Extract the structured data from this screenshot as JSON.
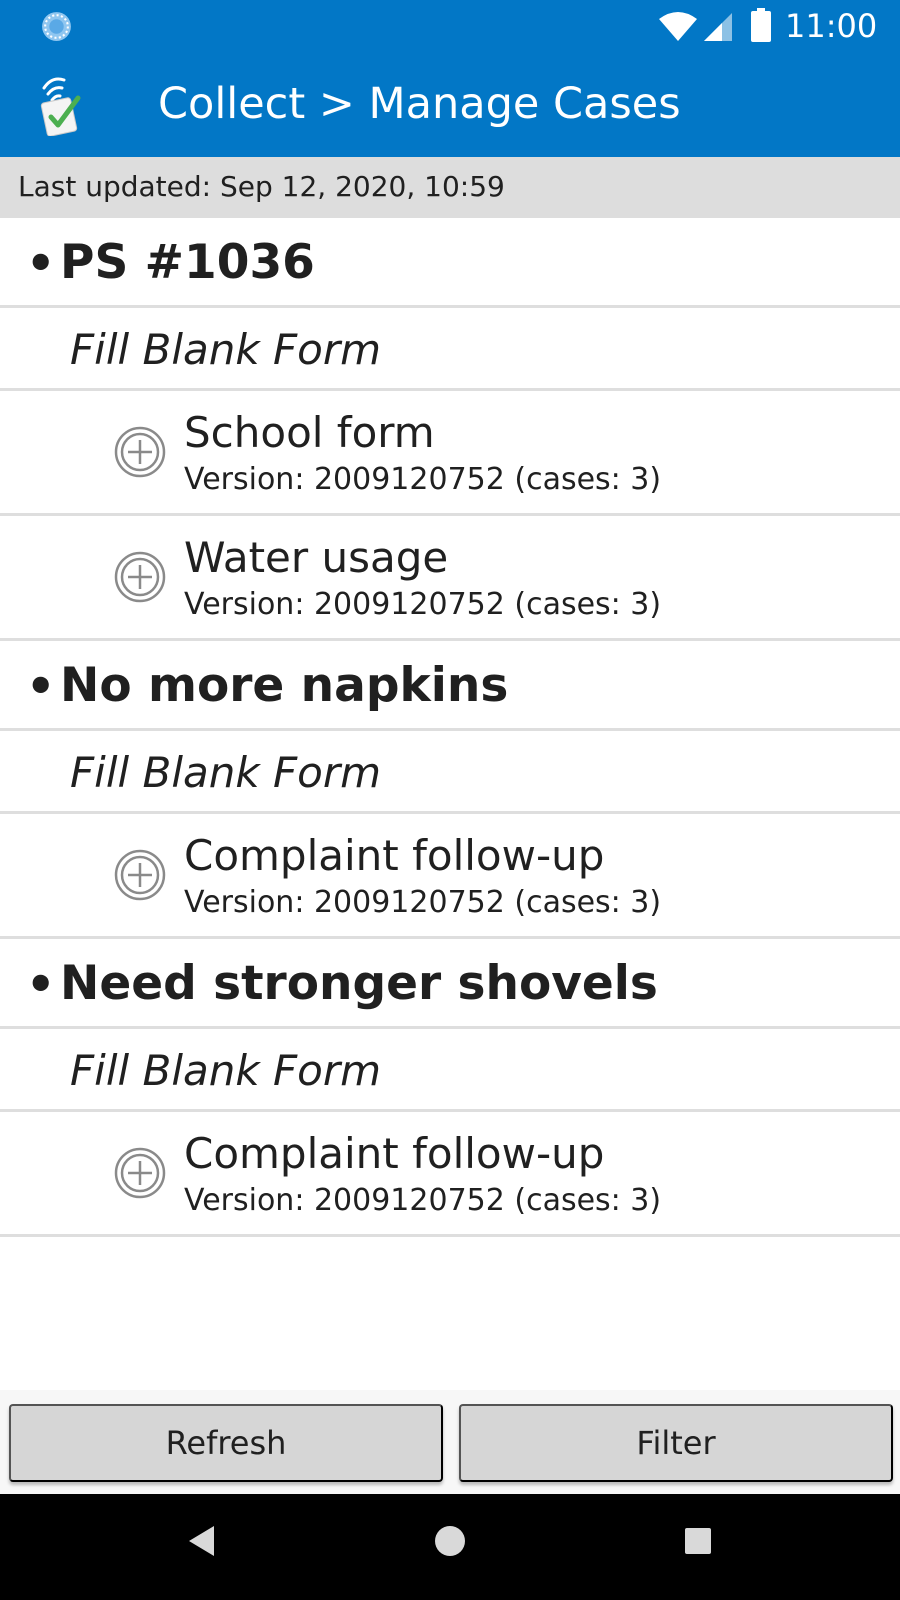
{
  "status_bar": {
    "time": "11:00",
    "icons": [
      "sync-icon",
      "wifi-icon",
      "signal-icon",
      "battery-icon"
    ]
  },
  "app_bar": {
    "title": "Collect > Manage Cases",
    "logo_icon": "collect-logo-icon",
    "background_color": "#0277c6"
  },
  "last_updated": "Last updated: Sep 12, 2020, 10:59",
  "cases": [
    {
      "bullet": "•",
      "title": "PS #1036",
      "action_label": "Fill Blank Form",
      "forms": [
        {
          "name": "School form",
          "version": "Version: 2009120752 (cases: 3)",
          "icon": "add-circle-icon"
        },
        {
          "name": "Water usage",
          "version": "Version: 2009120752 (cases: 3)",
          "icon": "add-circle-icon"
        }
      ]
    },
    {
      "bullet": "•",
      "title": "No more napkins",
      "action_label": "Fill Blank Form",
      "forms": [
        {
          "name": "Complaint follow-up",
          "version": "Version: 2009120752 (cases: 3)",
          "icon": "add-circle-icon"
        }
      ]
    },
    {
      "bullet": "•",
      "title": "Need stronger shovels",
      "action_label": "Fill Blank Form",
      "forms": [
        {
          "name": "Complaint follow-up",
          "version": "Version: 2009120752 (cases: 3)",
          "icon": "add-circle-icon"
        }
      ]
    }
  ],
  "buttons": {
    "refresh_label": "Refresh",
    "filter_label": "Filter"
  },
  "nav_bar": {
    "icons": [
      "back-icon",
      "home-icon",
      "recents-icon"
    ]
  }
}
